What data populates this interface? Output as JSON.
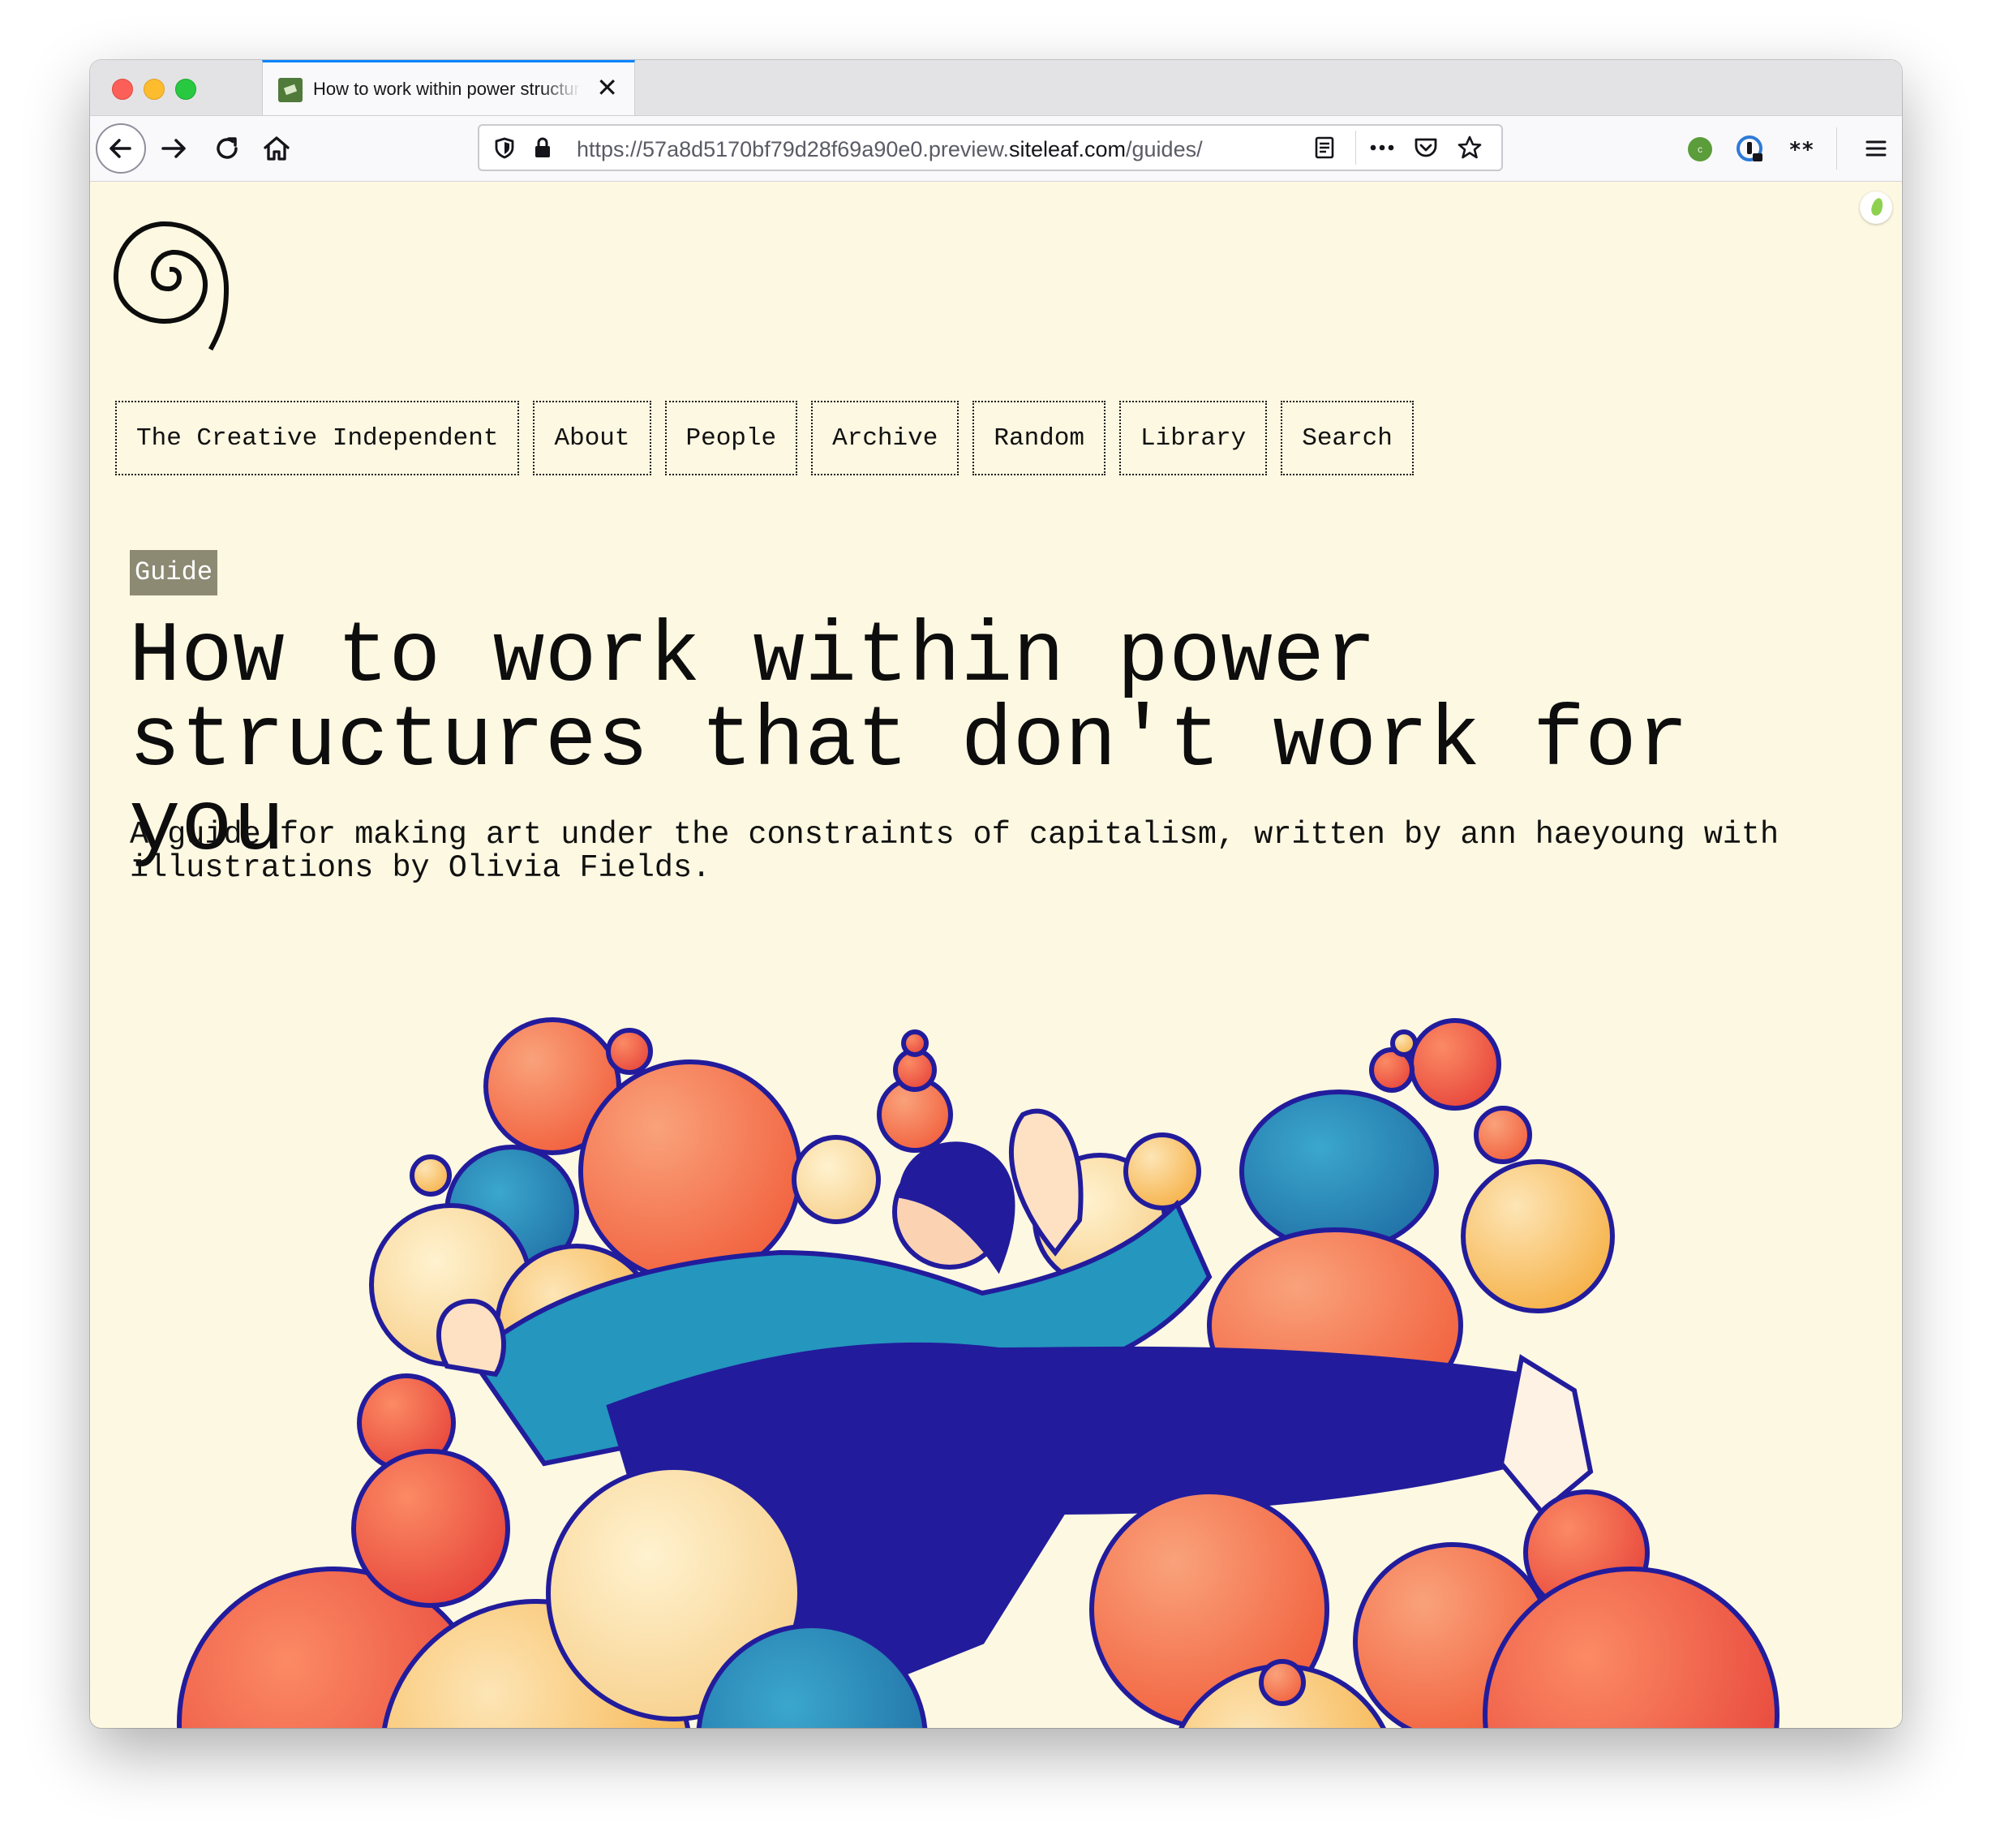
{
  "browser": {
    "tab": {
      "title": "How to work within power structures that don't work for you",
      "close_icon": "close-icon"
    },
    "url": {
      "prefix": "https://57a8d5170bf79d28f69a90e0.preview.",
      "host": "siteleaf.com",
      "path": "/guides/"
    },
    "icons": [
      "back-arrow-icon",
      "forward-arrow-icon",
      "reload-icon",
      "home-icon",
      "shield-icon",
      "lock-icon",
      "reader-view-icon",
      "more-actions-icon",
      "pocket-icon",
      "star-bookmark-icon",
      "extension-c-icon",
      "extension-1password-icon",
      "extension-asterisk-icon",
      "hamburger-menu-icon"
    ]
  },
  "site": {
    "nav": [
      "The Creative Independent",
      "About",
      "People",
      "Archive",
      "Random",
      "Library",
      "Search"
    ]
  },
  "article": {
    "tag": "Guide",
    "title": "How to work within power structures that don't work for you",
    "subtitle": "A guide for making art under the constraints of capitalism, written by ann haeyoung with illustrations by Olivia Fields."
  },
  "colors": {
    "page_background": "#fdf8e1",
    "tag_background": "#8d8a74",
    "illustration_navy": "#221c9c",
    "illustration_teal": "#2596be",
    "illustration_orange": "#f5774d",
    "illustration_yellow": "#f8c36a",
    "tab_accent": "#0a84ff"
  }
}
